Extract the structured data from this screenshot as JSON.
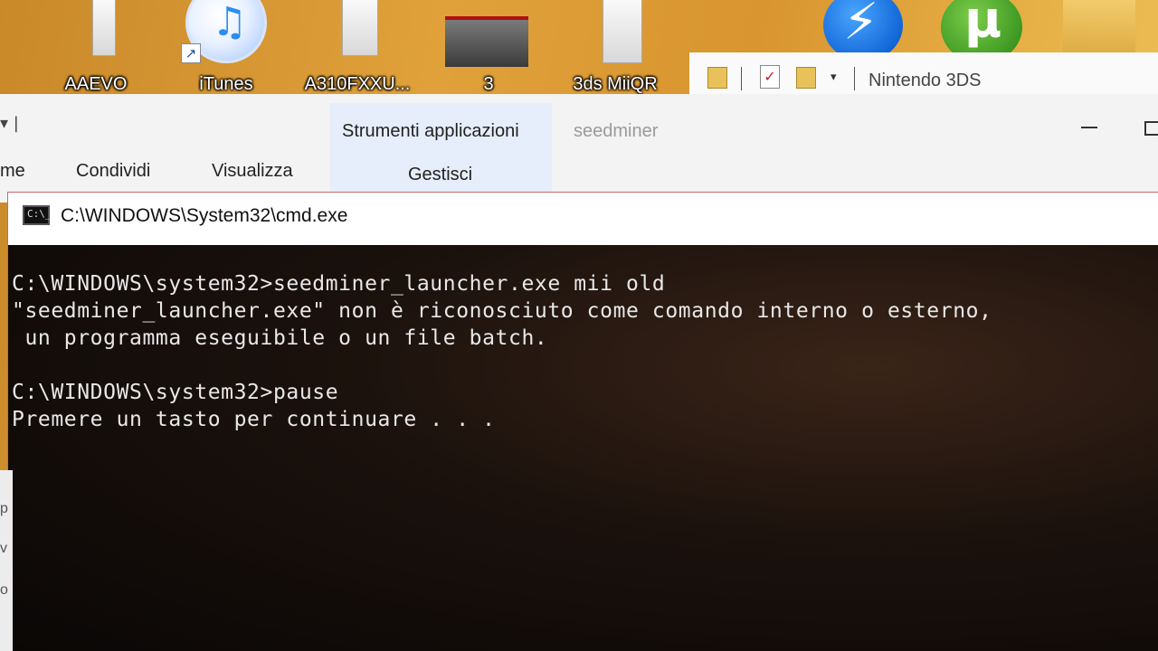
{
  "desktop": {
    "icons": [
      {
        "label": "AAEVO",
        "icon": "document-icon"
      },
      {
        "label": "iTunes",
        "icon": "itunes-icon"
      },
      {
        "label": "A310FXXU...",
        "icon": "document-icon"
      },
      {
        "label": "3",
        "icon": "3ds-image-icon"
      },
      {
        "label": "3ds MiiQR",
        "icon": "document-icon"
      },
      {
        "label": "",
        "icon": "bolt-app-icon"
      },
      {
        "label": "",
        "icon": "utorrent-icon"
      },
      {
        "label": "",
        "icon": "archive-icon"
      }
    ]
  },
  "explorer": {
    "title": "Nintendo 3DS",
    "context_tab_group": "Strumenti applicazioni",
    "context_tab_folder": "seedminer",
    "ribbon_tabs": [
      "me",
      "Condividi",
      "Visualizza",
      "Gestisci"
    ]
  },
  "cmd": {
    "title": "C:\\WINDOWS\\System32\\cmd.exe",
    "lines": [
      "C:\\WINDOWS\\system32>seedminer_launcher.exe mii old",
      "\"seedminer_launcher.exe\" non è riconosciuto come comando interno o esterno,",
      " un programma eseguibile o un file batch.",
      "",
      "C:\\WINDOWS\\system32>pause",
      "Premere un tasto per continuare . . ."
    ]
  },
  "left_fragment": [
    "p",
    "v",
    "o"
  ],
  "colors": {
    "desktop_bg": "#d9952f",
    "cmd_bg": "#0c0c0c",
    "cmd_text": "#e8e8e8",
    "context_tab_bg": "#e6eefb"
  }
}
